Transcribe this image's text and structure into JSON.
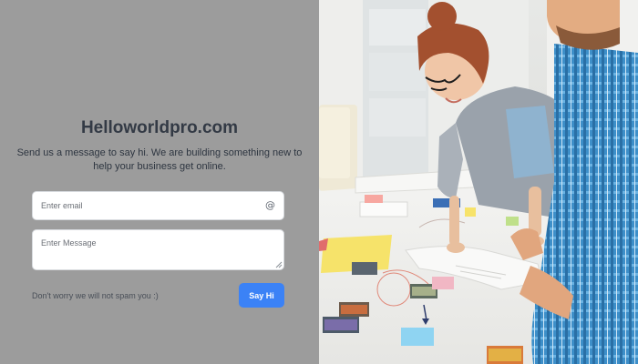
{
  "brand": {
    "title": "Helloworldpro.com"
  },
  "tagline": "Send us a message to say hi. We are building something new to help your business get online.",
  "form": {
    "email_placeholder": "Enter email",
    "email_icon": "at-sign-icon",
    "message_placeholder": "Enter Message",
    "disclaimer": "Don't worry we will not spam you :)",
    "submit_label": "Say Hi"
  },
  "colors": {
    "left_panel_background": "#9c9c9c",
    "accent": "#3b82f6",
    "title_text": "#333a45"
  },
  "hero_image": {
    "subject": "photo of two people reviewing papers and sticky notes on a table"
  }
}
